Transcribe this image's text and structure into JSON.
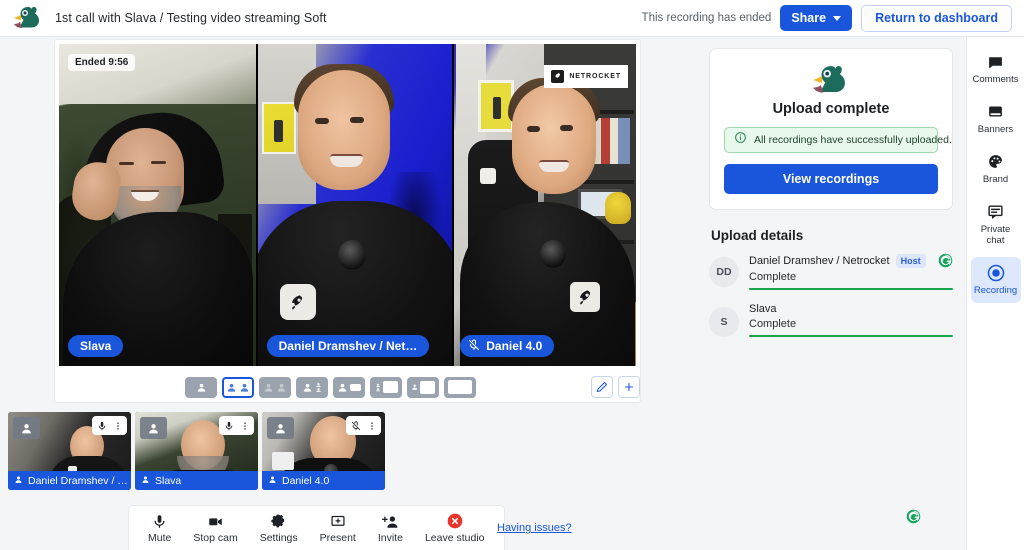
{
  "header": {
    "logo_icon": "duck-logo",
    "title": "1st call with Slava / Testing video streaming Soft",
    "ended_note": "This recording has ended",
    "share_label": "Share",
    "share_caret_icon": "chevron-down-icon",
    "return_label": "Return to dashboard"
  },
  "stage": {
    "ended_badge": "Ended 9:56",
    "watermark": "NETROCKET",
    "tiles": [
      {
        "name": "Slava",
        "muted": false
      },
      {
        "name": "Daniel Dramshev / Net…",
        "muted": false
      },
      {
        "name": "Daniel 4.0",
        "muted": true
      }
    ]
  },
  "layout_bar": {
    "selected_index": 1,
    "options": [
      "layout-single",
      "layout-two-equal",
      "layout-two-grey",
      "layout-one-plus-two",
      "layout-speaker-right",
      "layout-two-left-screen",
      "layout-small-left-screen",
      "layout-screen-only"
    ],
    "edit_icon": "pencil-icon",
    "add_icon": "plus-icon"
  },
  "thumbnails": [
    {
      "name": "Daniel Dramshev / …",
      "mic_icon": "mic-icon",
      "muted": false,
      "menu_icon": "more-vertical-icon",
      "avatar_icon": "person-icon"
    },
    {
      "name": "Slava",
      "mic_icon": "mic-icon",
      "muted": false,
      "menu_icon": "more-vertical-icon",
      "avatar_icon": "person-icon"
    },
    {
      "name": "Daniel 4.0",
      "mic_icon": "mic-off-icon",
      "muted": true,
      "menu_icon": "more-vertical-icon",
      "avatar_icon": "person-icon"
    }
  ],
  "toolbar": {
    "items": [
      {
        "label": "Mute",
        "icon": "microphone-icon"
      },
      {
        "label": "Stop cam",
        "icon": "video-camera-icon"
      },
      {
        "label": "Settings",
        "icon": "gear-icon"
      },
      {
        "label": "Present",
        "icon": "present-screen-icon"
      },
      {
        "label": "Invite",
        "icon": "add-person-icon"
      },
      {
        "label": "Leave studio",
        "icon": "leave-red-x-icon"
      }
    ],
    "having_issues": "Having issues?"
  },
  "right_panel": {
    "card": {
      "duck_icon": "duck-logo",
      "title": "Upload complete",
      "alert_icon": "info-circle-icon",
      "alert_text": "All recordings have successfully uploaded.",
      "view_button": "View recordings"
    },
    "details_title": "Upload details",
    "uploads": [
      {
        "initials": "DD",
        "name": "Daniel Dramshev / Netrocket",
        "badge": "Host",
        "status": "Complete",
        "progress": 100,
        "grammarly_icon": "grammarly-icon"
      },
      {
        "initials": "S",
        "name": "Slava",
        "badge": "",
        "status": "Complete",
        "progress": 100,
        "grammarly_icon": ""
      }
    ],
    "floating_grammarly_icon": "grammarly-icon"
  },
  "rail": {
    "items": [
      {
        "label": "Comments",
        "icon": "comment-icon",
        "active": false
      },
      {
        "label": "Banners",
        "icon": "banner-icon",
        "active": false
      },
      {
        "label": "Brand",
        "icon": "palette-icon",
        "active": false
      },
      {
        "label": "Private chat",
        "icon": "private-chat-icon",
        "active": false
      },
      {
        "label": "Recording",
        "icon": "record-dot-icon",
        "active": true
      }
    ]
  },
  "colors": {
    "accent": "#1a56db",
    "success": "#16a34a",
    "alert_bg": "#e8f8ed",
    "rail_active_bg": "#dde8fd",
    "danger": "#e8342a",
    "page_bg": "#f4f5f7"
  }
}
